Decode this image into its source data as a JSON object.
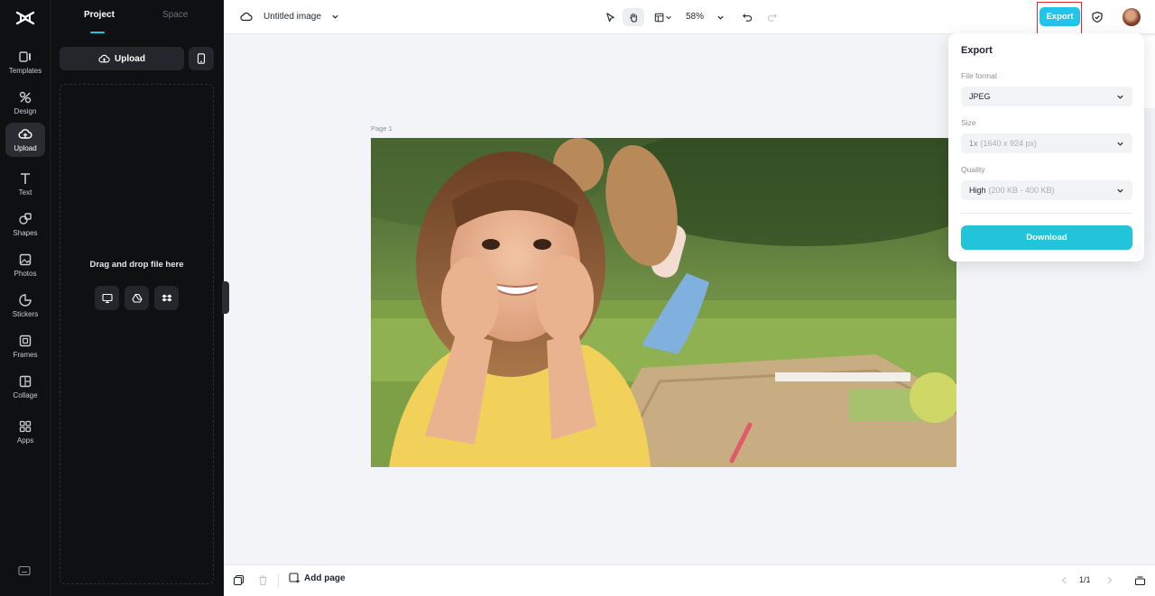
{
  "rail": {
    "items": [
      {
        "label": "Templates",
        "icon": "templates-icon"
      },
      {
        "label": "Design",
        "icon": "design-icon"
      },
      {
        "label": "Upload",
        "icon": "upload-cloud-icon"
      },
      {
        "label": "Text",
        "icon": "text-icon"
      },
      {
        "label": "Shapes",
        "icon": "shapes-icon"
      },
      {
        "label": "Photos",
        "icon": "photos-icon"
      },
      {
        "label": "Stickers",
        "icon": "stickers-icon"
      },
      {
        "label": "Frames",
        "icon": "frames-icon"
      },
      {
        "label": "Collage",
        "icon": "collage-icon"
      },
      {
        "label": "Apps",
        "icon": "apps-icon"
      }
    ],
    "active": "Upload"
  },
  "panel": {
    "tabs": [
      {
        "label": "Project"
      },
      {
        "label": "Space"
      }
    ],
    "upload_label": "Upload",
    "drop_text": "Drag and drop file here"
  },
  "topbar": {
    "doc_title": "Untitled image",
    "zoom": "58%",
    "export_label": "Export"
  },
  "canvas": {
    "page_label": "Page 1"
  },
  "bottombar": {
    "add_page": "Add page",
    "page_count": "1/1"
  },
  "export_popover": {
    "title": "Export",
    "file_format_label": "File format",
    "file_format_value": "JPEG",
    "size_label": "Size",
    "size_value": "1x",
    "size_detail": "(1640 x 924 px)",
    "quality_label": "Quality",
    "quality_value": "High",
    "quality_detail": "(200 KB - 400 KB)",
    "download_label": "Download"
  },
  "colors": {
    "accent": "#22c4dc",
    "export_button": "#22c4ea",
    "highlight": "#e02d2d"
  }
}
